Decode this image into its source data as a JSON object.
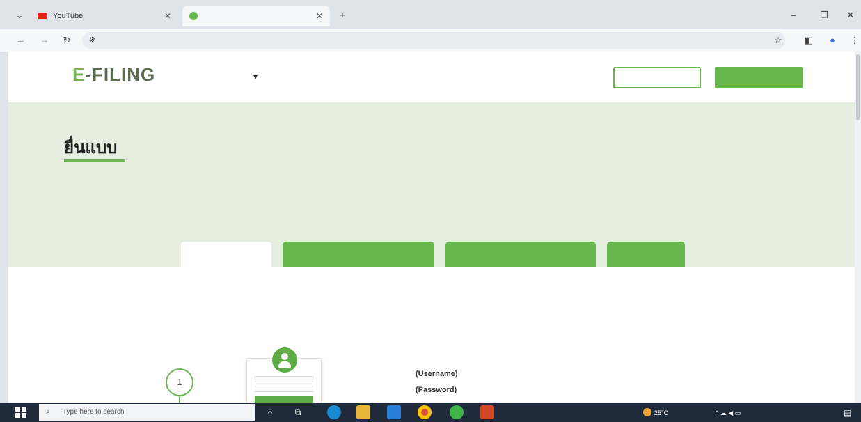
{
  "browser": {
    "tabs": [
      {
        "title": "YouTube",
        "favicon_color": "#e62117",
        "active": false
      },
      {
        "title": "",
        "favicon_color": "#66b84c",
        "active": true
      }
    ],
    "new_tab": "+",
    "url": "",
    "window_controls": {
      "minimize": "–",
      "restore": "❐",
      "close": "✕"
    }
  },
  "site": {
    "logo": {
      "text_e": "E",
      "text_rest": "-FILING",
      "subtitle": ""
    },
    "nav": [
      {
        "label": ""
      },
      {
        "label": ""
      },
      {
        "label": ""
      },
      {
        "label": ""
      },
      {
        "label": ""
      }
    ],
    "login_button": "",
    "register_button": ""
  },
  "hero": {
    "title": "ยื่นแบบ",
    "description": "",
    "tabs": [
      {
        "label": "",
        "active": true
      },
      {
        "label": "",
        "active": false
      },
      {
        "label": "",
        "active": false
      },
      {
        "label": "",
        "active": false
      }
    ]
  },
  "content": {
    "description": "",
    "step_number": "1",
    "login_hints": [
      "(Username)",
      "(Password)"
    ]
  },
  "taskbar": {
    "search_placeholder": "Type here to search",
    "weather": "25°C",
    "weather_desc": "",
    "time": "",
    "date": ""
  },
  "colors": {
    "brand_green": "#66b84c",
    "hero_bg": "#e6efdf",
    "taskbar": "#1f2a3a"
  }
}
